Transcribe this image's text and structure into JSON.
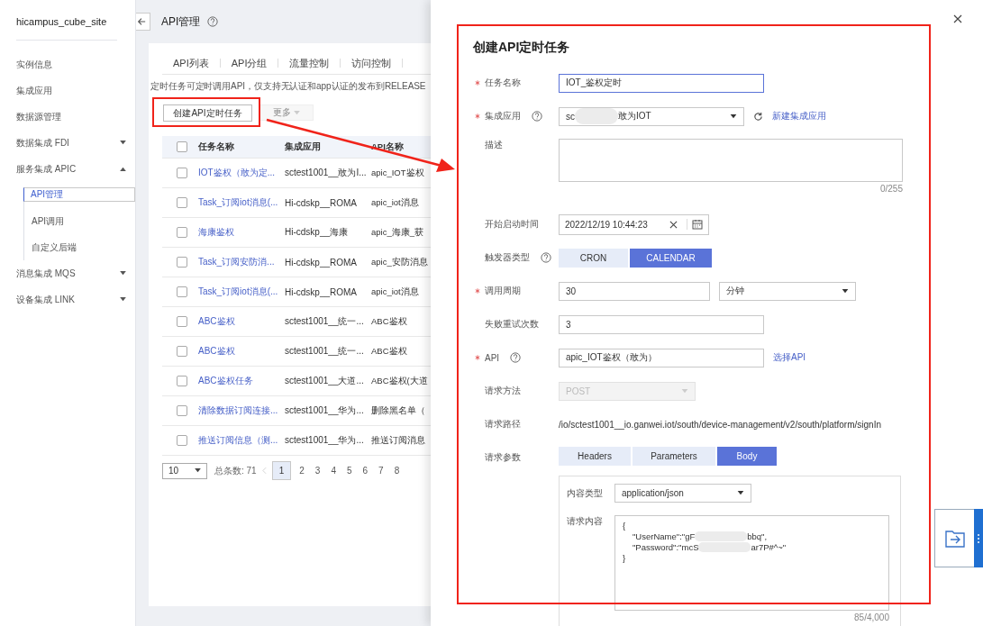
{
  "sidebar": {
    "title": "hicampus_cube_site",
    "items": [
      {
        "kind": "link",
        "label": "实例信息"
      },
      {
        "kind": "link",
        "label": "集成应用"
      },
      {
        "kind": "link",
        "label": "数据源管理"
      },
      {
        "kind": "group",
        "label": "数据集成 FDI",
        "expanded": false
      },
      {
        "kind": "group",
        "label": "服务集成 APIC",
        "expanded": true,
        "children": [
          {
            "label": "API管理",
            "selected": true
          },
          {
            "label": "API调用",
            "selected": false
          },
          {
            "label": "自定义后端",
            "selected": false
          }
        ]
      },
      {
        "kind": "group",
        "label": "消息集成 MQS",
        "expanded": false
      },
      {
        "kind": "group",
        "label": "设备集成 LINK",
        "expanded": false
      }
    ]
  },
  "main": {
    "title": "API管理",
    "tabs": [
      "API列表",
      "API分组",
      "流量控制",
      "访问控制"
    ],
    "notice": "定时任务可定时调用API，仅支持无认证和app认证的发布到RELEASE",
    "create_button": "创建API定时任务",
    "more_button": {
      "label": "更多",
      "disabled": true
    },
    "table": {
      "columns": [
        "任务名称",
        "集成应用",
        "API名称"
      ],
      "all_checked": false,
      "rows": [
        {
          "checked": false,
          "name": "IOT鉴权（敢为定...",
          "app": "sctest1001__敢为I...",
          "api": "apic_IOT鉴权"
        },
        {
          "checked": false,
          "name": "Task_订阅iot消息(...",
          "app": "Hi-cdskp__ROMA",
          "api": "apic_iot消息"
        },
        {
          "checked": false,
          "name": "海康鉴权",
          "app": "Hi-cdskp__海康",
          "api": "apic_海康_获"
        },
        {
          "checked": false,
          "name": "Task_订阅安防消...",
          "app": "Hi-cdskp__ROMA",
          "api": "apic_安防消息"
        },
        {
          "checked": false,
          "name": "Task_订阅iot消息(...",
          "app": "Hi-cdskp__ROMA",
          "api": "apic_iot消息"
        },
        {
          "checked": false,
          "name": "ABC鉴权",
          "app": "sctest1001__统一...",
          "api": "ABC鉴权"
        },
        {
          "checked": false,
          "name": "ABC鉴权",
          "app": "sctest1001__统一...",
          "api": "ABC鉴权"
        },
        {
          "checked": false,
          "name": "ABC鉴权任务",
          "app": "sctest1001__大道...",
          "api": "ABC鉴权(大道"
        },
        {
          "checked": false,
          "name": "清除数据订阅连接...",
          "app": "sctest1001__华为...",
          "api": "删除黑名单（"
        },
        {
          "checked": false,
          "name": "推送订阅信息（测...",
          "app": "sctest1001__华为...",
          "api": "推送订阅消息"
        }
      ]
    },
    "pagination": {
      "page_size": "10",
      "total": "总条数: 71",
      "pages": [
        {
          "label": "1",
          "selected": true
        },
        {
          "label": "2",
          "selected": false
        },
        {
          "label": "3",
          "selected": false
        },
        {
          "label": "4",
          "selected": false
        },
        {
          "label": "5",
          "selected": false
        },
        {
          "label": "6",
          "selected": false
        },
        {
          "label": "7",
          "selected": false
        },
        {
          "label": "8",
          "selected": false
        }
      ]
    }
  },
  "drawer": {
    "title": "创建API定时任务",
    "fields": [
      {
        "kind": "input",
        "label": "任务名称",
        "required": true,
        "help": false,
        "value": "IOT_鉴权定时",
        "focused": true
      },
      {
        "kind": "select",
        "label": "集成应用",
        "required": true,
        "help": true,
        "value_start": "sc",
        "value_end": "敢为IOT",
        "redacted": true,
        "refresh": true,
        "action_link": "新建集成应用"
      },
      {
        "kind": "textarea",
        "label": "描述",
        "required": false,
        "help": false,
        "counter": "0/255"
      },
      {
        "kind": "datetime",
        "label": "开始启动时间",
        "required": false,
        "help": false,
        "value": "2022/12/19 10:44:23"
      },
      {
        "kind": "segmented",
        "label": "触发器类型",
        "required": false,
        "help": true,
        "options": [
          {
            "label": "CRON",
            "selected": false
          },
          {
            "label": "CALENDAR",
            "selected": true
          }
        ]
      },
      {
        "kind": "period",
        "label": "调用周期",
        "required": true,
        "help": false,
        "value": "30",
        "unit": "分钟"
      },
      {
        "kind": "input",
        "label": "失败重试次数",
        "required": false,
        "help": false,
        "value": "3",
        "focused": false
      },
      {
        "kind": "input",
        "label": "API",
        "required": true,
        "help": true,
        "value": "apic_IOT鉴权（敢为）",
        "focused": false,
        "action_link": "选择API"
      },
      {
        "kind": "select",
        "label": "请求方法",
        "required": false,
        "help": false,
        "value_start": "POST",
        "disabled": true
      },
      {
        "kind": "text",
        "label": "请求路径",
        "required": false,
        "help": false,
        "value": "/io/sctest1001__io.ganwei.iot/south/device-management/v2/south/platform/signIn"
      },
      {
        "kind": "params",
        "label": "请求参数",
        "required": false,
        "help": false,
        "tabs": [
          {
            "label": "Headers",
            "selected": false
          },
          {
            "label": "Parameters",
            "selected": false
          },
          {
            "label": "Body",
            "selected": true
          }
        ],
        "content_type_label": "内容类型",
        "content_type": "application/json",
        "body_label": "请求内容",
        "body_lines": [
          {
            "parts": [
              "{"
            ]
          },
          {
            "parts": [
              "\"UserName\":\"gF",
              "bbq\","
            ]
          },
          {
            "parts": [
              "\"Password\":\"mcS",
              "ar7P#^~\""
            ]
          },
          {
            "parts": [
              "}"
            ]
          }
        ],
        "counter": "85/4,000"
      }
    ]
  }
}
